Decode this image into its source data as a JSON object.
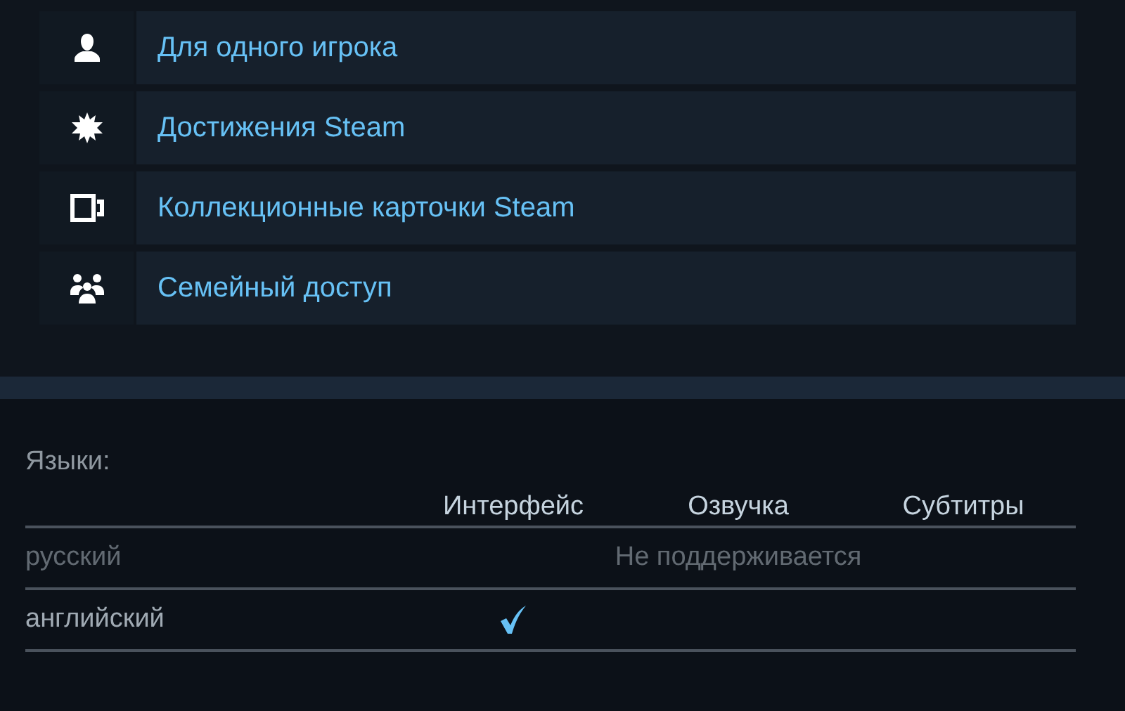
{
  "features": [
    {
      "kind": "single-player",
      "label": "Для одного игрока"
    },
    {
      "kind": "achievements",
      "label": "Достижения Steam"
    },
    {
      "kind": "trading-cards",
      "label": "Коллекционные карточки Steam"
    },
    {
      "kind": "family-sharing",
      "label": "Семейный доступ"
    }
  ],
  "languages": {
    "title": "Языки:",
    "columns": [
      "Интерфейс",
      "Озвучка",
      "Субтитры"
    ],
    "rows": [
      {
        "name": "русский",
        "supported": false,
        "note": "Не поддерживается"
      },
      {
        "name": "английский",
        "supported": true,
        "interface": true,
        "voice": false,
        "subtitles": false
      }
    ]
  }
}
